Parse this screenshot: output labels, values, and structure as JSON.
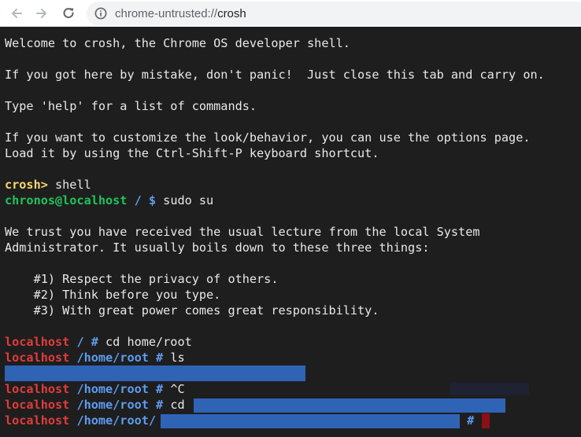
{
  "browser": {
    "url_scheme": "chrome-untrusted://",
    "url_host": "crosh",
    "back_icon": "arrow-left-icon",
    "forward_icon": "arrow-right-icon",
    "reload_icon": "reload-icon",
    "info_icon": "info-icon"
  },
  "terminal": {
    "welcome": "Welcome to crosh, the Chrome OS developer shell.",
    "mistake": "If you got here by mistake, don't panic!  Just close this tab and carry on.",
    "help": "Type 'help' for a list of commands.",
    "customize1": "If you want to customize the look/behavior, you can use the options page.",
    "customize2": "Load it by using the Ctrl-Shift-P keyboard shortcut.",
    "crosh_prompt": "crosh>",
    "crosh_cmd": " shell",
    "chronos_user": "chronos@localhost",
    "chronos_path": " / $",
    "chronos_cmd": " sudo su",
    "lecture1": "We trust you have received the usual lecture from the local System",
    "lecture2": "Administrator. It usually boils down to these three things:",
    "rule1": "    #1) Respect the privacy of others.",
    "rule2": "    #2) Think before you type.",
    "rule3": "    #3) With great power comes great responsibility.",
    "host": "localhost",
    "root_path": " / #",
    "cmd_cd_home": " cd home/root",
    "home_root_path": " /home/root #",
    "cmd_ls": " ls",
    "cmd_ctrl_c": " ^C",
    "cmd_cd": " cd",
    "home_root_sub_path": " /home/root/",
    "prompt_hash": " #",
    "colors": {
      "background": "#1e1e1e",
      "text": "#e8e8e8",
      "prompt_yellow": "#f5d76e",
      "prompt_green": "#1fc35a",
      "path_blue": "#5d9cf0",
      "root_red": "#e23b3b",
      "redaction": "#2f63b6",
      "cursor": "#8b0f15"
    }
  }
}
